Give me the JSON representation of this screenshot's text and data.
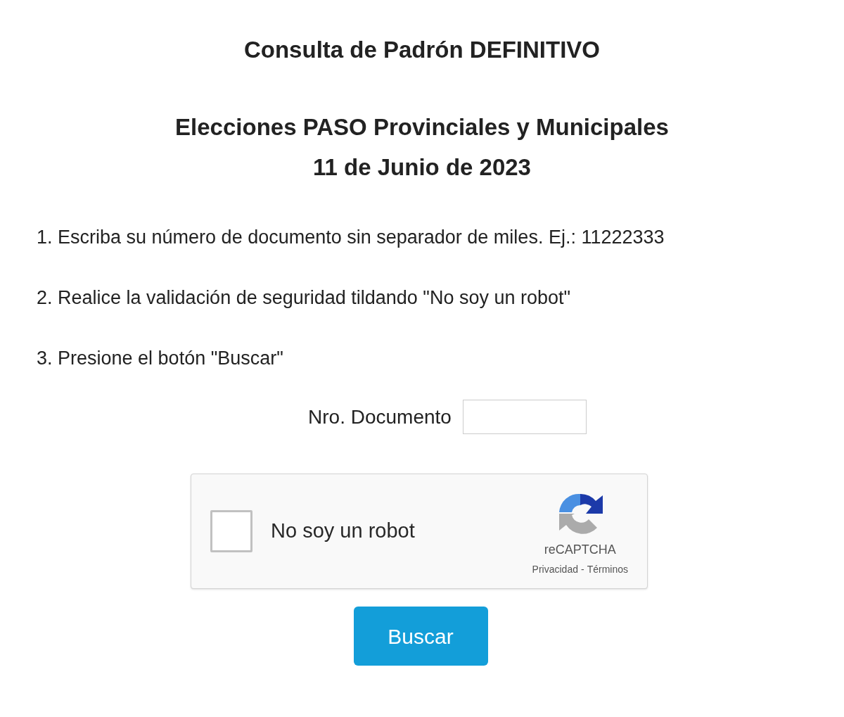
{
  "title": "Consulta de Padrón DEFINITIVO",
  "subtitle_lines": [
    "Elecciones PASO Provinciales y Municipales",
    "11 de Junio de 2023"
  ],
  "instructions": [
    "1. Escriba su número de documento sin separador de miles. Ej.: 11222333",
    "2. Realice la validación de seguridad tildando \"No soy un robot\"",
    "3. Presione el botón \"Buscar\""
  ],
  "document_field": {
    "label": "Nro. Documento"
  },
  "captcha": {
    "label": "No soy un robot",
    "checked": false,
    "brand": "reCAPTCHA",
    "links": [
      "Privacidad",
      "Términos"
    ],
    "separator": "-"
  },
  "submit_button": "Buscar"
}
